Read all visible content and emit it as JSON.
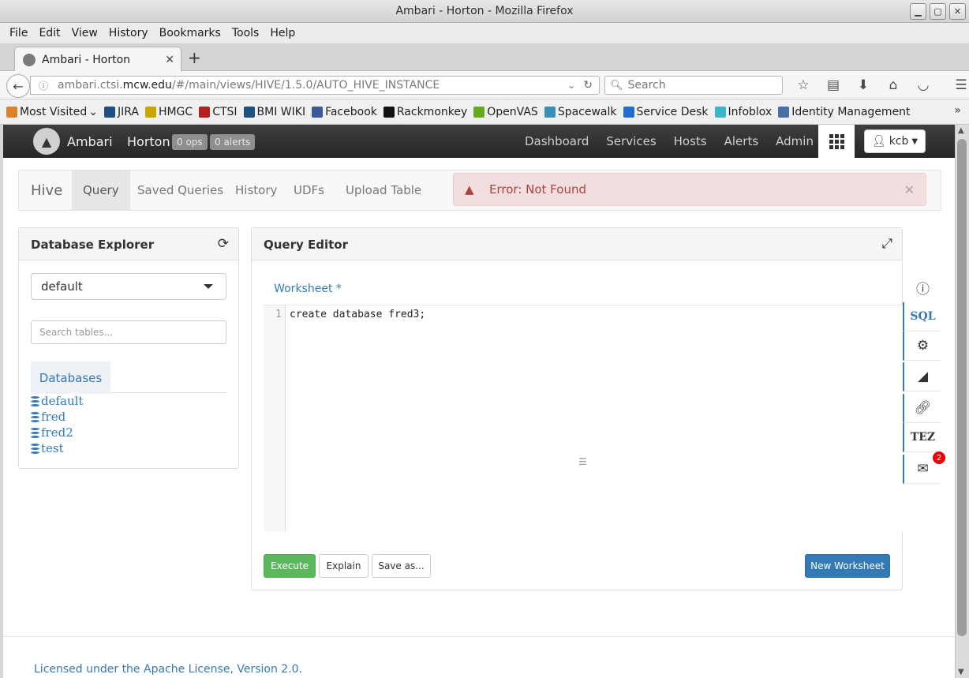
{
  "window": {
    "title": "Ambari - Horton - Mozilla Firefox"
  },
  "menu": [
    "File",
    "Edit",
    "View",
    "History",
    "Bookmarks",
    "Tools",
    "Help"
  ],
  "tab": {
    "title": "Ambari - Horton"
  },
  "nav": {
    "url_host": "ambari.ctsi.",
    "url_domain": "mcw.edu",
    "url_path": "/#/main/views/HIVE/1.5.0/AUTO_HIVE_INSTANCE",
    "search_placeholder": "Search"
  },
  "bookmarks": [
    {
      "label": "Most Visited",
      "icon": "most-visited-icon",
      "color": "#d9822b"
    },
    {
      "label": "JIRA",
      "icon": "jira-icon",
      "color": "#205081"
    },
    {
      "label": "HMGC",
      "icon": "hmgc-icon",
      "color": "#c8a600"
    },
    {
      "label": "CTSI",
      "icon": "ctsi-icon",
      "color": "#b32020"
    },
    {
      "label": "BMI WIKI",
      "icon": "bmi-wiki-icon",
      "color": "#20507f"
    },
    {
      "label": "Facebook",
      "icon": "facebook-icon",
      "color": "#3b5998"
    },
    {
      "label": "Rackmonkey",
      "icon": "rackmonkey-icon",
      "color": "#111111"
    },
    {
      "label": "OpenVAS",
      "icon": "openvas-icon",
      "color": "#66aa22"
    },
    {
      "label": "Spacewalk",
      "icon": "spacewalk-icon",
      "color": "#3a8fb7"
    },
    {
      "label": "Service Desk",
      "icon": "service-desk-icon",
      "color": "#1f6fd1"
    },
    {
      "label": "Infoblox",
      "icon": "infoblox-icon",
      "color": "#3cb7c9"
    },
    {
      "label": "Identity Management",
      "icon": "identity-management-icon",
      "color": "#4a6fa5"
    }
  ],
  "ambari": {
    "brand": "Ambari",
    "cluster": "Horton",
    "ops": "0 ops",
    "alerts": "0 alerts",
    "topnav": [
      "Dashboard",
      "Services",
      "Hosts",
      "Alerts",
      "Admin"
    ],
    "user": "kcb"
  },
  "hive": {
    "title": "Hive",
    "tabs": [
      "Query",
      "Saved Queries",
      "History",
      "UDFs",
      "Upload Table"
    ],
    "error": "Error: Not Found"
  },
  "explorer": {
    "title": "Database Explorer",
    "selected_db": "default",
    "search_placeholder": "Search tables...",
    "tab": "Databases",
    "databases": [
      "default",
      "fred",
      "fred2",
      "test"
    ]
  },
  "editor": {
    "title": "Query Editor",
    "worksheet": "Worksheet *",
    "line_number": "1",
    "code": "create database fred3;",
    "execute": "Execute",
    "explain": "Explain",
    "save_as": "Save as...",
    "new_worksheet": "New Worksheet"
  },
  "sidetools": {
    "sql": "SQL",
    "tez": "TEZ",
    "notifications": "2"
  },
  "footer": {
    "license": "Licensed under the Apache License, Version 2.0."
  }
}
